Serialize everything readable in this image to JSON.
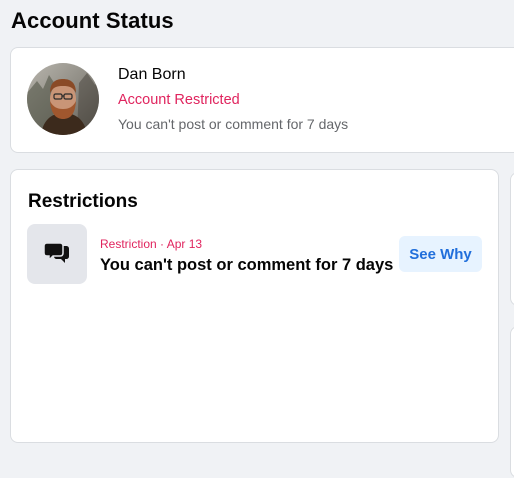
{
  "page": {
    "title": "Account Status"
  },
  "profile": {
    "name": "Dan Born",
    "status": "Account Restricted",
    "detail": "You can't post or comment for 7 days"
  },
  "restrictions": {
    "title": "Restrictions",
    "items": [
      {
        "icon": "chat-bubbles-icon",
        "meta_type": "Restriction",
        "meta_separator": " · ",
        "meta_date": "Apr 13",
        "text": "You can't post or comment for 7 days",
        "action_label": "See Why"
      }
    ]
  },
  "colors": {
    "restricted_red": "#e0245e",
    "button_blue_text": "#216fdb",
    "button_blue_bg": "#e7f3ff",
    "secondary_text": "#65676b",
    "background": "#f0f2f5"
  }
}
